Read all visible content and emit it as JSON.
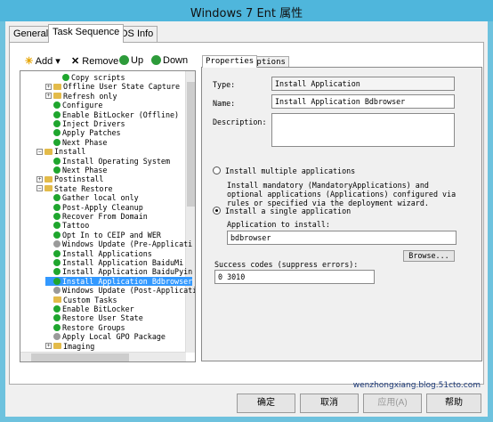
{
  "window": {
    "title": "Windows 7 Ent 属性"
  },
  "tabs": [
    {
      "label": "General"
    },
    {
      "label": "Task Sequence"
    },
    {
      "label": "OS Info"
    }
  ],
  "toolbar": {
    "add": "Add",
    "remove": "Remove",
    "up": "Up",
    "down": "Down"
  },
  "tree": [
    {
      "label": "Copy scripts",
      "indent": 3,
      "icon": "green"
    },
    {
      "label": "Offline User State Capture",
      "indent": 2,
      "icon": "folder",
      "exp": "+"
    },
    {
      "label": "Refresh only",
      "indent": 2,
      "icon": "folder",
      "exp": "+"
    },
    {
      "label": "Configure",
      "indent": 2,
      "icon": "green"
    },
    {
      "label": "Enable BitLocker (Offline)",
      "indent": 2,
      "icon": "green"
    },
    {
      "label": "Inject Drivers",
      "indent": 2,
      "icon": "green"
    },
    {
      "label": "Apply Patches",
      "indent": 2,
      "icon": "green"
    },
    {
      "label": "Next Phase",
      "indent": 2,
      "icon": "green"
    },
    {
      "label": "Install",
      "indent": 1,
      "icon": "folder",
      "exp": "−"
    },
    {
      "label": "Install Operating System",
      "indent": 2,
      "icon": "green"
    },
    {
      "label": "Next Phase",
      "indent": 2,
      "icon": "green"
    },
    {
      "label": "Postinstall",
      "indent": 1,
      "icon": "folder",
      "exp": "+"
    },
    {
      "label": "State Restore",
      "indent": 1,
      "icon": "folder",
      "exp": "−"
    },
    {
      "label": "Gather local only",
      "indent": 2,
      "icon": "green"
    },
    {
      "label": "Post-Apply Cleanup",
      "indent": 2,
      "icon": "green"
    },
    {
      "label": "Recover From Domain",
      "indent": 2,
      "icon": "green"
    },
    {
      "label": "Tattoo",
      "indent": 2,
      "icon": "green"
    },
    {
      "label": "Opt In to CEIP and WER",
      "indent": 2,
      "icon": "green"
    },
    {
      "label": "Windows Update (Pre-Applicati",
      "indent": 2,
      "icon": "gray"
    },
    {
      "label": "Install Applications",
      "indent": 2,
      "icon": "green"
    },
    {
      "label": "Install Application BaiduMi",
      "indent": 2,
      "icon": "green"
    },
    {
      "label": "Install Application BaiduPyin",
      "indent": 2,
      "icon": "green"
    },
    {
      "label": "Install Application Bdbrowser",
      "indent": 2,
      "icon": "green",
      "selected": true
    },
    {
      "label": "Windows Update (Post-Applicati",
      "indent": 2,
      "icon": "gray"
    },
    {
      "label": "Custom Tasks",
      "indent": 2,
      "icon": "folder"
    },
    {
      "label": "Enable BitLocker",
      "indent": 2,
      "icon": "green"
    },
    {
      "label": "Restore User State",
      "indent": 2,
      "icon": "green"
    },
    {
      "label": "Restore Groups",
      "indent": 2,
      "icon": "green"
    },
    {
      "label": "Apply Local GPO Package",
      "indent": 2,
      "icon": "gray"
    },
    {
      "label": "Imaging",
      "indent": 2,
      "icon": "folder",
      "exp": "+"
    }
  ],
  "props": {
    "tabs": [
      "Properties",
      "Options"
    ],
    "type_label": "Type:",
    "type_value": "Install Application",
    "name_label": "Name:",
    "name_value": "Install Application Bdbrowser",
    "desc_label": "Description:",
    "desc_value": "",
    "radio_multi": "Install multiple applications",
    "multi_help": "Install mandatory (MandatoryApplications) and optional applications (Applications) configured via rules or specified via the deployment wizard.",
    "radio_single": "Install a single application",
    "app_label": "Application to install:",
    "app_value": "bdbrowser",
    "browse": "Browse...",
    "success_label": "Success codes (suppress errors):",
    "success_value": "0 3010"
  },
  "buttons": {
    "ok": "确定",
    "cancel": "取消",
    "apply": "应用(A)",
    "help": "帮助"
  },
  "watermark": "wenzhongxiang.blog.51cto.com"
}
